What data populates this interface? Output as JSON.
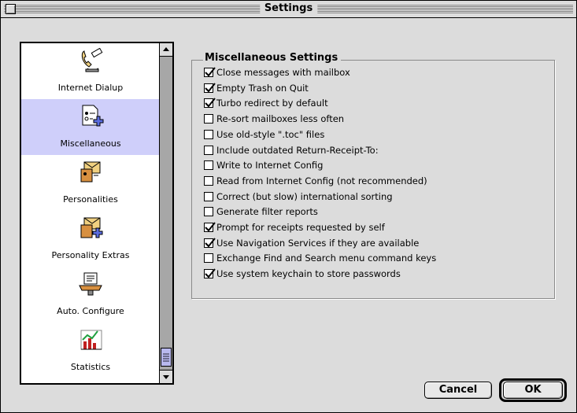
{
  "window": {
    "title": "Settings"
  },
  "sidebar": {
    "items": [
      {
        "label": "Internet Dialup",
        "icon": "dialup-phone-icon",
        "selected": false
      },
      {
        "label": "Miscellaneous",
        "icon": "miscellaneous-icon",
        "selected": true
      },
      {
        "label": "Personalities",
        "icon": "personalities-icon",
        "selected": false
      },
      {
        "label": "Personality Extras",
        "icon": "personality-extras-icon",
        "selected": false
      },
      {
        "label": "Auto. Configure",
        "icon": "auto-configure-icon",
        "selected": false
      },
      {
        "label": "Statistics",
        "icon": "statistics-icon",
        "selected": false
      }
    ]
  },
  "panel": {
    "title": "Miscellaneous Settings",
    "options": [
      {
        "label": "Close messages with mailbox",
        "checked": true
      },
      {
        "label": "Empty Trash on Quit",
        "checked": true
      },
      {
        "label": "Turbo redirect by default",
        "checked": true
      },
      {
        "label": "Re-sort mailboxes less often",
        "checked": false
      },
      {
        "label": "Use old-style \".toc\" files",
        "checked": false
      },
      {
        "label": "Include outdated Return-Receipt-To:",
        "checked": false
      },
      {
        "label": "Write to Internet Config",
        "checked": false
      },
      {
        "label": "Read from Internet Config (not recommended)",
        "checked": false
      },
      {
        "label": "Correct (but slow) international sorting",
        "checked": false
      },
      {
        "label": "Generate filter reports",
        "checked": false
      },
      {
        "label": "Prompt for receipts requested by self",
        "checked": true
      },
      {
        "label": "Use Navigation Services if they are available",
        "checked": true
      },
      {
        "label": "Exchange Find and Search menu command keys",
        "checked": false
      },
      {
        "label": "Use system keychain to store passwords",
        "checked": true
      }
    ]
  },
  "buttons": {
    "cancel": "Cancel",
    "ok": "OK"
  },
  "colors": {
    "selection": "#cfcffa",
    "window_bg": "#dcdcdc",
    "thumb": "#b8b8ee"
  }
}
